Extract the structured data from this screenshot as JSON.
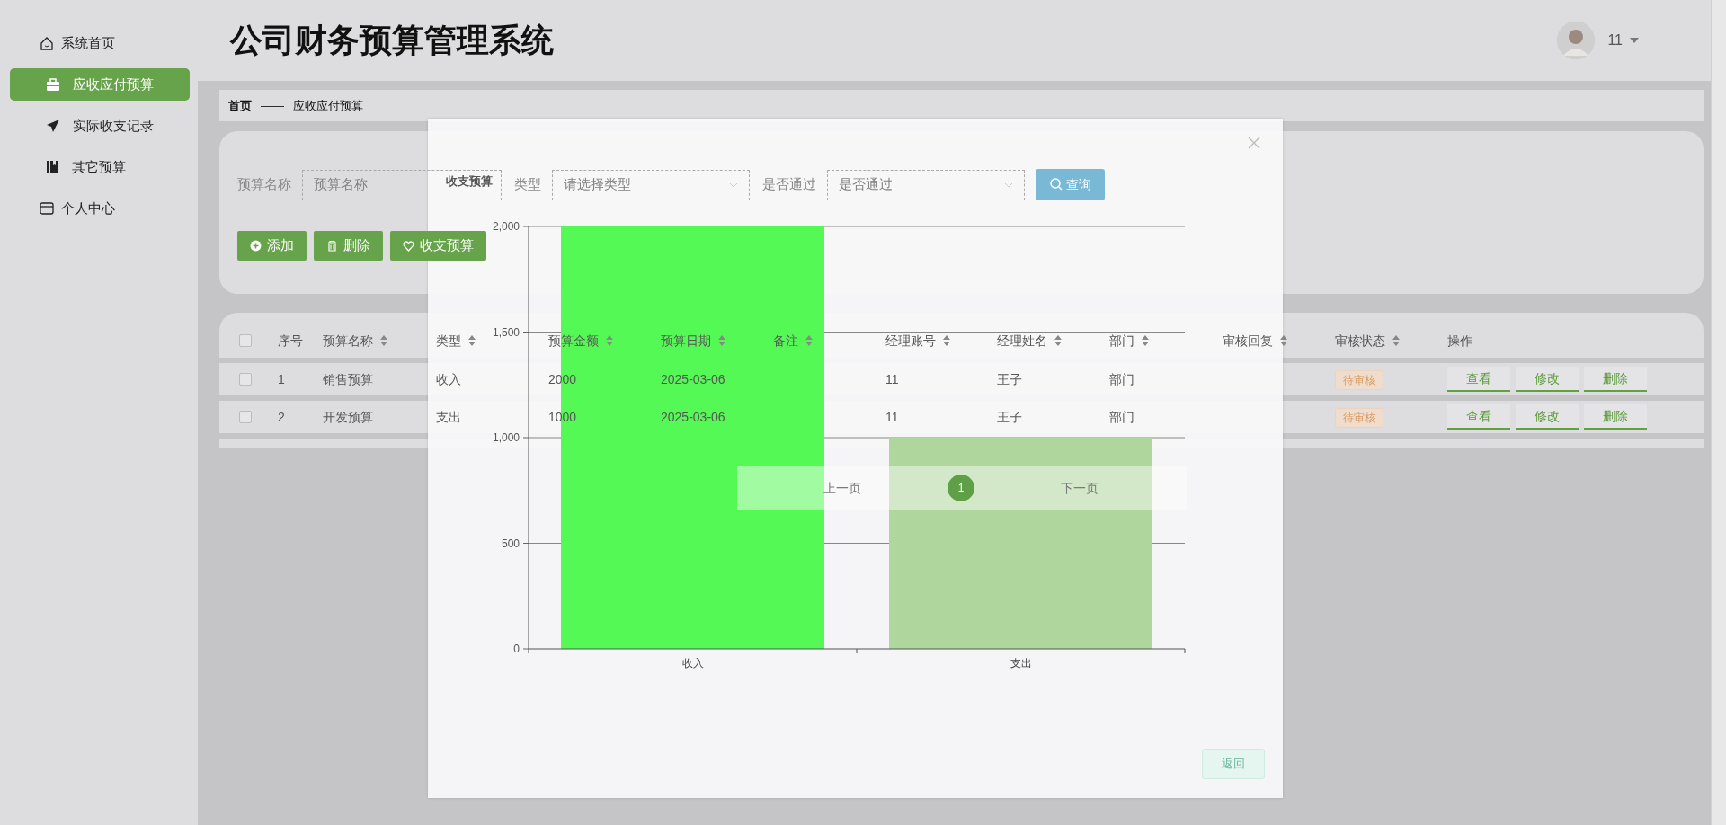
{
  "sidebar": {
    "items": [
      {
        "kind": "main",
        "label": "系统首页",
        "selected": false
      },
      {
        "kind": "sub",
        "label": "应收应付预算",
        "selected": true
      },
      {
        "kind": "sub",
        "label": "实际收支记录",
        "selected": false
      },
      {
        "kind": "sub",
        "label": "其它预算",
        "selected": false
      },
      {
        "kind": "main",
        "label": "个人中心",
        "selected": false
      }
    ]
  },
  "header": {
    "title": "公司财务预算管理系统",
    "user": "11"
  },
  "breadcrumb": {
    "home": "首页",
    "separator": "——",
    "current": "应收应付预算"
  },
  "search": {
    "fields": [
      {
        "kind": "input",
        "label": "预算名称",
        "placeholder": "预算名称"
      },
      {
        "kind": "select",
        "label": "类型",
        "placeholder": "请选择类型"
      },
      {
        "kind": "select",
        "label": "是否通过",
        "placeholder": "是否通过"
      }
    ],
    "button": "查询"
  },
  "actions": [
    {
      "label": "添加"
    },
    {
      "label": "删除"
    },
    {
      "label": "收支预算"
    }
  ],
  "table": {
    "all_checked": false,
    "columns": [
      {
        "label": "序号",
        "sortable": false
      },
      {
        "label": "预算名称",
        "sortable": true
      },
      {
        "label": "类型",
        "sortable": true
      },
      {
        "label": "预算金额",
        "sortable": true
      },
      {
        "label": "预算日期",
        "sortable": true
      },
      {
        "label": "备注",
        "sortable": true
      },
      {
        "label": "经理账号",
        "sortable": true
      },
      {
        "label": "经理姓名",
        "sortable": true
      },
      {
        "label": "部门",
        "sortable": true
      },
      {
        "label": "审核回复",
        "sortable": true
      },
      {
        "label": "审核状态",
        "sortable": true
      },
      {
        "label": "操作",
        "sortable": false
      }
    ],
    "rows": [
      {
        "checked": false,
        "cells": [
          "1",
          "销售预算",
          "收入",
          "2000",
          "2025-03-06",
          null,
          "11",
          "王子",
          "部门",
          null
        ],
        "status": "待审核",
        "buttons": [
          "查看",
          "修改",
          "删除"
        ]
      },
      {
        "checked": false,
        "cells": [
          "2",
          "开发预算",
          "支出",
          "1000",
          "2025-03-06",
          null,
          "11",
          "王子",
          "部门",
          null
        ],
        "status": "待审核",
        "buttons": [
          "查看",
          "修改",
          "删除"
        ]
      }
    ]
  },
  "pagination": {
    "prev": "上一页",
    "pages": [
      {
        "label": "1",
        "selected": true
      }
    ],
    "next": "下一页"
  },
  "modal": {
    "title": "收支预算",
    "back_button": "返回",
    "chart_data": {
      "type": "bar",
      "categories": [
        "收入",
        "支出"
      ],
      "stacked": true,
      "grid": true,
      "series": [
        {
          "color": "#55f955",
          "values": [
            2000,
            null
          ]
        },
        {
          "color": "#aed69d",
          "values": [
            null,
            1000
          ]
        }
      ],
      "ylim": [
        0,
        2000
      ],
      "yticks": [
        {
          "value": 0,
          "label": "0"
        },
        {
          "value": 500,
          "label": "500"
        },
        {
          "value": 1000,
          "label": "1,000"
        },
        {
          "value": 1500,
          "label": "1,500"
        },
        {
          "value": 2000,
          "label": "2,000"
        }
      ]
    }
  }
}
